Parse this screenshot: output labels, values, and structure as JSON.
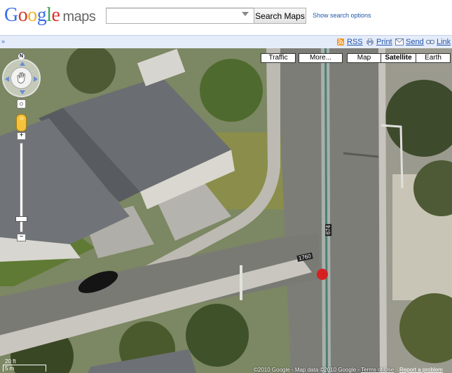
{
  "header": {
    "logo_google": "Google",
    "logo_maps": "maps",
    "search": {
      "value": "",
      "button_label": "Search Maps"
    },
    "search_options_label": "Show search options"
  },
  "toolbar": {
    "collapse_label": "»",
    "rss_label": "RSS",
    "print_label": "Print",
    "send_label": "Send",
    "link_label": "Link"
  },
  "map": {
    "type_buttons": {
      "traffic": "Traffic",
      "more": "More...",
      "map": "Map",
      "satellite": "Satellite",
      "earth": "Earth"
    },
    "active_type": "Satellite",
    "compass_label": "N",
    "zoom_in_label": "+",
    "zoom_out_label": "−",
    "zoom_level_fraction": 0.15,
    "street_labels": {
      "vertical": "674",
      "horizontal": "1760"
    },
    "scale": {
      "feet": "20 ft",
      "meters": "5 m"
    },
    "copyright": "©2010 Google - Map data ©2010 Google - ",
    "terms_label": "Terms of Use",
    "report_label": "Report a problem"
  },
  "colors": {
    "logo_blue": "#3a6ee8",
    "logo_red": "#d8342a",
    "logo_yellow": "#f1b51c",
    "logo_green": "#3aa757",
    "toolbar_bg": "#e5ecf9",
    "link_blue": "#2255aa"
  },
  "icons": {
    "rss": "rss-feed-icon",
    "print": "printer-icon",
    "send": "envelope-icon",
    "link": "chain-link-icon",
    "pegman": "street-view-pegman-icon",
    "incident": "red-fire-hydrant-marker-icon"
  }
}
